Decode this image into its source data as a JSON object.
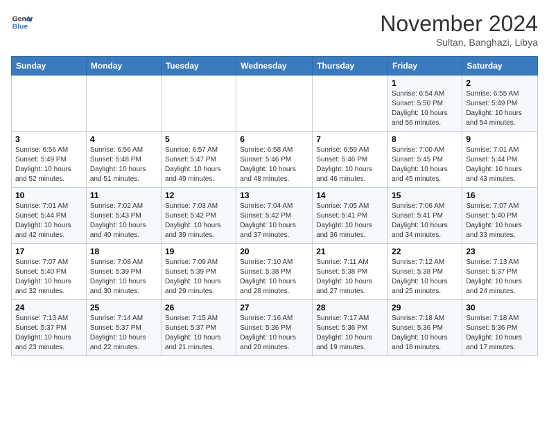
{
  "logo": {
    "line1": "General",
    "line2": "Blue"
  },
  "title": "November 2024",
  "subtitle": "Sultan, Banghazi, Libya",
  "weekdays": [
    "Sunday",
    "Monday",
    "Tuesday",
    "Wednesday",
    "Thursday",
    "Friday",
    "Saturday"
  ],
  "weeks": [
    [
      {
        "day": "",
        "info": ""
      },
      {
        "day": "",
        "info": ""
      },
      {
        "day": "",
        "info": ""
      },
      {
        "day": "",
        "info": ""
      },
      {
        "day": "",
        "info": ""
      },
      {
        "day": "1",
        "info": "Sunrise: 6:54 AM\nSunset: 5:50 PM\nDaylight: 10 hours\nand 56 minutes."
      },
      {
        "day": "2",
        "info": "Sunrise: 6:55 AM\nSunset: 5:49 PM\nDaylight: 10 hours\nand 54 minutes."
      }
    ],
    [
      {
        "day": "3",
        "info": "Sunrise: 6:56 AM\nSunset: 5:49 PM\nDaylight: 10 hours\nand 52 minutes."
      },
      {
        "day": "4",
        "info": "Sunrise: 6:56 AM\nSunset: 5:48 PM\nDaylight: 10 hours\nand 51 minutes."
      },
      {
        "day": "5",
        "info": "Sunrise: 6:57 AM\nSunset: 5:47 PM\nDaylight: 10 hours\nand 49 minutes."
      },
      {
        "day": "6",
        "info": "Sunrise: 6:58 AM\nSunset: 5:46 PM\nDaylight: 10 hours\nand 48 minutes."
      },
      {
        "day": "7",
        "info": "Sunrise: 6:59 AM\nSunset: 5:46 PM\nDaylight: 10 hours\nand 46 minutes."
      },
      {
        "day": "8",
        "info": "Sunrise: 7:00 AM\nSunset: 5:45 PM\nDaylight: 10 hours\nand 45 minutes."
      },
      {
        "day": "9",
        "info": "Sunrise: 7:01 AM\nSunset: 5:44 PM\nDaylight: 10 hours\nand 43 minutes."
      }
    ],
    [
      {
        "day": "10",
        "info": "Sunrise: 7:01 AM\nSunset: 5:44 PM\nDaylight: 10 hours\nand 42 minutes."
      },
      {
        "day": "11",
        "info": "Sunrise: 7:02 AM\nSunset: 5:43 PM\nDaylight: 10 hours\nand 40 minutes."
      },
      {
        "day": "12",
        "info": "Sunrise: 7:03 AM\nSunset: 5:42 PM\nDaylight: 10 hours\nand 39 minutes."
      },
      {
        "day": "13",
        "info": "Sunrise: 7:04 AM\nSunset: 5:42 PM\nDaylight: 10 hours\nand 37 minutes."
      },
      {
        "day": "14",
        "info": "Sunrise: 7:05 AM\nSunset: 5:41 PM\nDaylight: 10 hours\nand 36 minutes."
      },
      {
        "day": "15",
        "info": "Sunrise: 7:06 AM\nSunset: 5:41 PM\nDaylight: 10 hours\nand 34 minutes."
      },
      {
        "day": "16",
        "info": "Sunrise: 7:07 AM\nSunset: 5:40 PM\nDaylight: 10 hours\nand 33 minutes."
      }
    ],
    [
      {
        "day": "17",
        "info": "Sunrise: 7:07 AM\nSunset: 5:40 PM\nDaylight: 10 hours\nand 32 minutes."
      },
      {
        "day": "18",
        "info": "Sunrise: 7:08 AM\nSunset: 5:39 PM\nDaylight: 10 hours\nand 30 minutes."
      },
      {
        "day": "19",
        "info": "Sunrise: 7:09 AM\nSunset: 5:39 PM\nDaylight: 10 hours\nand 29 minutes."
      },
      {
        "day": "20",
        "info": "Sunrise: 7:10 AM\nSunset: 5:38 PM\nDaylight: 10 hours\nand 28 minutes."
      },
      {
        "day": "21",
        "info": "Sunrise: 7:11 AM\nSunset: 5:38 PM\nDaylight: 10 hours\nand 27 minutes."
      },
      {
        "day": "22",
        "info": "Sunrise: 7:12 AM\nSunset: 5:38 PM\nDaylight: 10 hours\nand 25 minutes."
      },
      {
        "day": "23",
        "info": "Sunrise: 7:13 AM\nSunset: 5:37 PM\nDaylight: 10 hours\nand 24 minutes."
      }
    ],
    [
      {
        "day": "24",
        "info": "Sunrise: 7:13 AM\nSunset: 5:37 PM\nDaylight: 10 hours\nand 23 minutes."
      },
      {
        "day": "25",
        "info": "Sunrise: 7:14 AM\nSunset: 5:37 PM\nDaylight: 10 hours\nand 22 minutes."
      },
      {
        "day": "26",
        "info": "Sunrise: 7:15 AM\nSunset: 5:37 PM\nDaylight: 10 hours\nand 21 minutes."
      },
      {
        "day": "27",
        "info": "Sunrise: 7:16 AM\nSunset: 5:36 PM\nDaylight: 10 hours\nand 20 minutes."
      },
      {
        "day": "28",
        "info": "Sunrise: 7:17 AM\nSunset: 5:36 PM\nDaylight: 10 hours\nand 19 minutes."
      },
      {
        "day": "29",
        "info": "Sunrise: 7:18 AM\nSunset: 5:36 PM\nDaylight: 10 hours\nand 18 minutes."
      },
      {
        "day": "30",
        "info": "Sunrise: 7:18 AM\nSunset: 5:36 PM\nDaylight: 10 hours\nand 17 minutes."
      }
    ]
  ]
}
